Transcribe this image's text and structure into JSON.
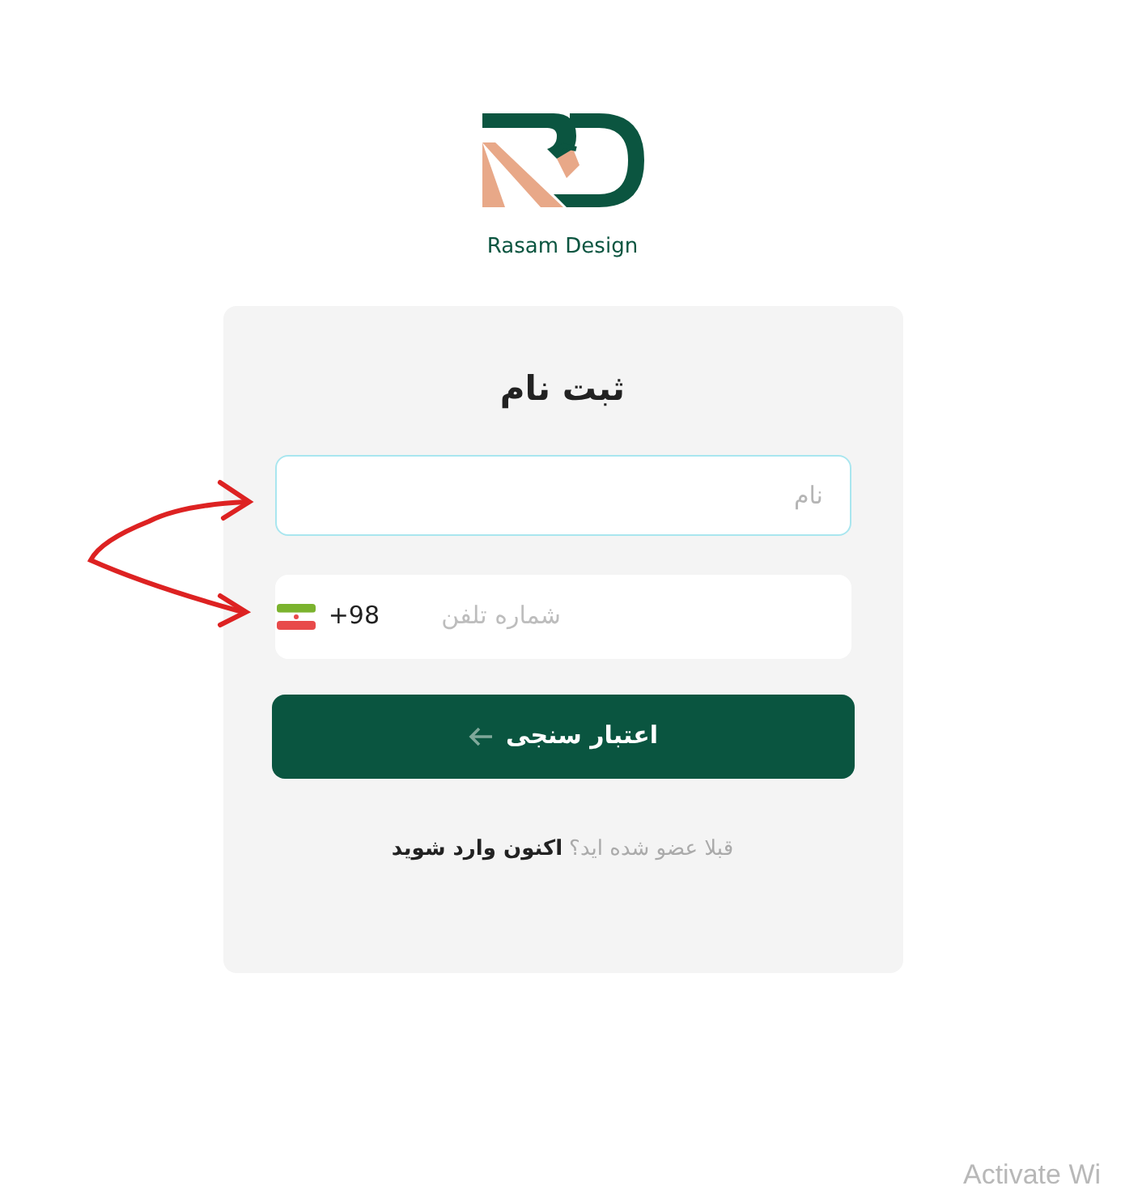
{
  "logo": {
    "caption": "Rasam Design"
  },
  "form": {
    "title": "ثبت نام",
    "fields": [
      {
        "kind": "text",
        "placeholder": "نام",
        "focused": true
      },
      {
        "kind": "phone",
        "placeholder": "شماره تلفن",
        "prefix": "+98",
        "focused": false
      }
    ],
    "submit": {
      "label": "اعتبار سنجی"
    },
    "footer": {
      "question": "قبلا عضو شده اید؟",
      "link": "اکنون وارد شوید"
    }
  },
  "os_notice": "Activate Wi"
}
